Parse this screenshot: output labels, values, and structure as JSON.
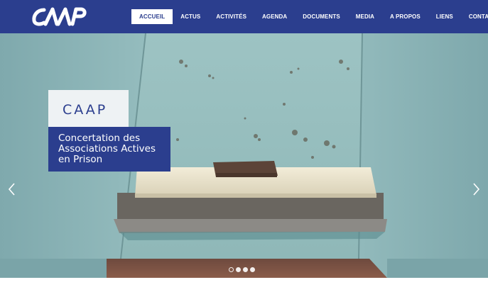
{
  "colors": {
    "brand": "#2b3e8e",
    "nav_text": "#ffffff",
    "active_bg": "#ffffff"
  },
  "header": {
    "logo_text": "CAAP",
    "nav": [
      {
        "label": "ACCUEIL",
        "active": true
      },
      {
        "label": "ACTUS"
      },
      {
        "label": "ACTIVITÉS"
      },
      {
        "label": "AGENDA"
      },
      {
        "label": "DOCUMENTS"
      },
      {
        "label": "MEDIA"
      },
      {
        "label": "A PROPOS"
      },
      {
        "label": "LIENS"
      },
      {
        "label": "CONTACT"
      }
    ]
  },
  "slider": {
    "title": "CAAP",
    "subtitle": "Concertation des Associations Actives en Prison",
    "prev_icon": "chevron-left-icon",
    "next_icon": "chevron-right-icon",
    "slide_count": 4,
    "active_slide": 1
  }
}
